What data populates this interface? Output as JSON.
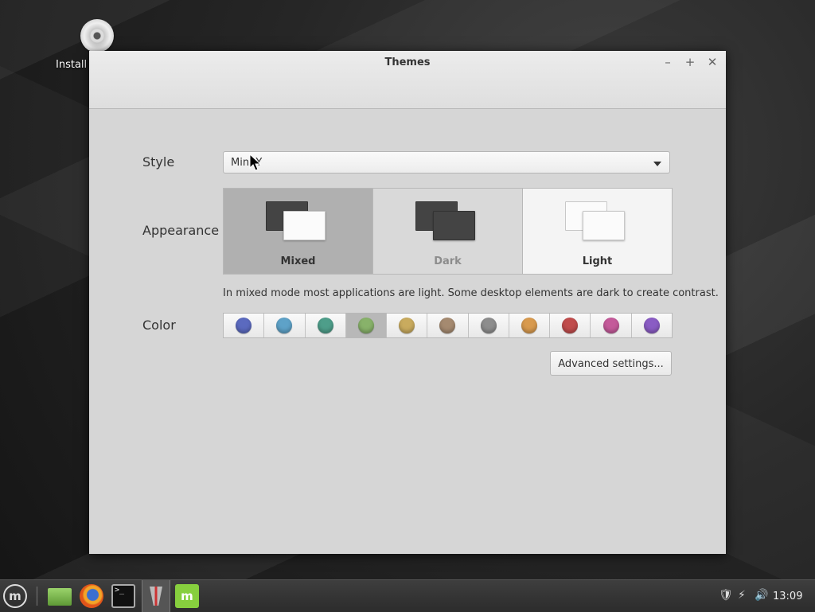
{
  "desktop": {
    "install_icon": "disc-icon",
    "install_label": "Install"
  },
  "window": {
    "title": "Themes",
    "controls": {
      "minimize": "–",
      "maximize": "+",
      "close": "✕"
    }
  },
  "style": {
    "label": "Style",
    "value": "Mint-Y"
  },
  "appearance": {
    "label": "Appearance",
    "options": [
      {
        "label": "Mixed",
        "selected": true
      },
      {
        "label": "Dark",
        "selected": false
      },
      {
        "label": "Light",
        "selected": false
      }
    ],
    "description": "In mixed mode most applications are light. Some desktop elements are dark to create contrast."
  },
  "color": {
    "label": "Color",
    "selected_index": 3,
    "swatches": [
      "#5b6abf",
      "#5ea2c8",
      "#4e9e8a",
      "#88b26a",
      "#c9ab5e",
      "#a58a70",
      "#8d8d8d",
      "#d89a4e",
      "#c04c4c",
      "#c45a9a",
      "#8a5cc4"
    ]
  },
  "advanced": {
    "label": "Advanced settings..."
  },
  "taskbar": {
    "menu_label": "m",
    "mint_label": "m",
    "terminal_label": ">_",
    "tray": {
      "shield": "🛡",
      "network": "⚡",
      "volume": "🔊"
    },
    "clock": "13:09"
  }
}
